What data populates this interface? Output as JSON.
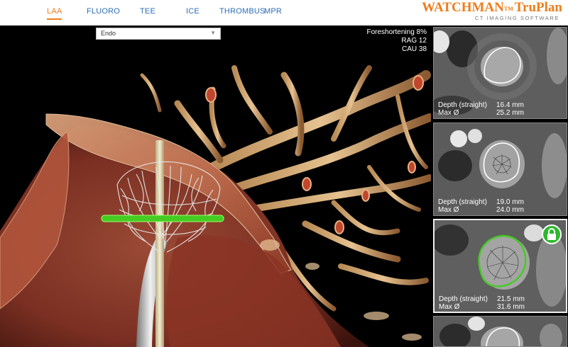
{
  "tabs": [
    {
      "label": "LAA",
      "active": true
    },
    {
      "label": "FLUORO",
      "active": false
    },
    {
      "label": "TEE",
      "active": false
    },
    {
      "label": "ICE",
      "active": false
    },
    {
      "label": "THROMBUS",
      "active": false
    },
    {
      "label": "MPR",
      "active": false
    }
  ],
  "brand": {
    "name": "WATCHMAN",
    "tm": "TM",
    "product": "TruPlan",
    "subtitle": "CT IMAGING SOFTWARE"
  },
  "view_select": {
    "value": "Endo"
  },
  "overlay": {
    "foreshortening": "Foreshortening 8%",
    "rag": "RAG 12",
    "cau": "CAU 38"
  },
  "panels": [
    {
      "depth_label": "Depth (straight)",
      "depth_value": "16.4 mm",
      "max_label": "Max Ø",
      "max_value": "25.2 mm",
      "locked": false
    },
    {
      "depth_label": "Depth (straight)",
      "depth_value": "19.0 mm",
      "max_label": "Max Ø",
      "max_value": "24.0 mm",
      "locked": false
    },
    {
      "depth_label": "Depth (straight)",
      "depth_value": "21.5 mm",
      "max_label": "Max Ø",
      "max_value": "31.6 mm",
      "locked": true
    },
    {
      "depth_label": "",
      "depth_value": "",
      "max_label": "",
      "max_value": "",
      "locked": false
    }
  ],
  "colors": {
    "accent": "#ee7d1a",
    "tab": "#2c6fb5",
    "lock": "#2eb82e",
    "device_ring": "#44cc22"
  },
  "icons": {
    "dropdown": "chevron-down-icon",
    "lock": "lock-icon"
  }
}
